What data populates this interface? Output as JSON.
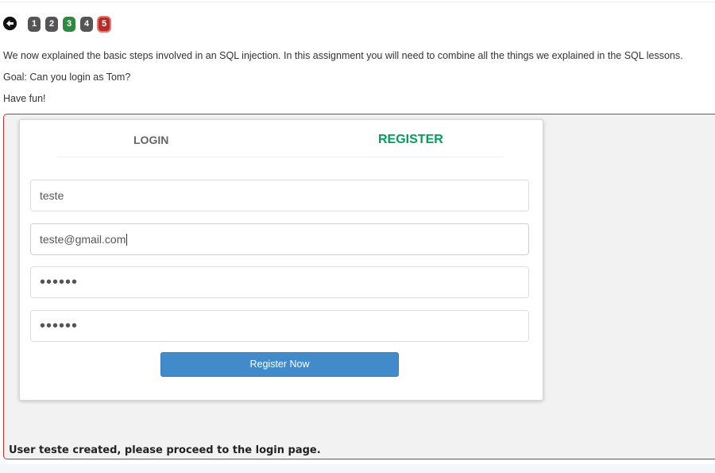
{
  "nav": {
    "pages": [
      "1",
      "2",
      "3",
      "4",
      "5"
    ],
    "completed_page": "3",
    "current_page": "5"
  },
  "intro": {
    "line1": "We now explained the basic steps involved in an SQL injection. In this assignment you will need to combine all the things we explained in the SQL lessons.",
    "line2": "Goal: Can you login as Tom?",
    "line3": "Have fun!"
  },
  "form": {
    "tab_login": "LOGIN",
    "tab_register": "REGISTER",
    "username_value": "teste",
    "email_value": "teste@gmail.com",
    "password_value": "••••••",
    "confirm_password_value": "••••••",
    "submit_label": "Register Now"
  },
  "feedback": "User teste created, please proceed to the login page.",
  "colors": {
    "register_tab": "#029f5b",
    "button": "#428bca",
    "completed": "#2d8a3e",
    "current": "#b52b27",
    "container_border": "#c9302c"
  },
  "icons": {
    "back": "circle-arrow-left-icon"
  }
}
